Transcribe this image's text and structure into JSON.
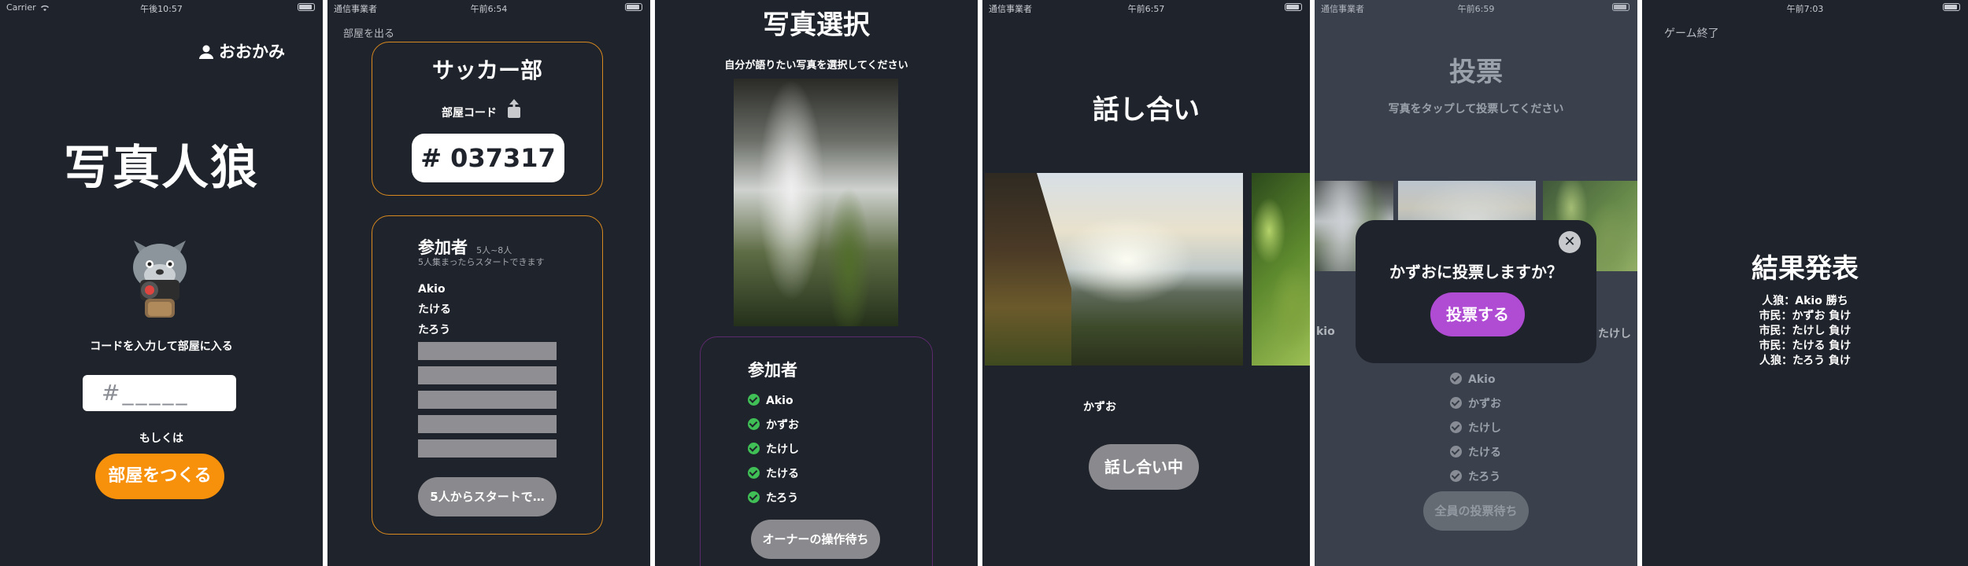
{
  "screens": {
    "s1": {
      "status": {
        "carrier": "Carrier",
        "time": "午後10:57"
      },
      "user_name": "おおかみ",
      "title": "写真人狼",
      "prompt": "コードを入力して部屋に入る",
      "code_placeholder": "#_____",
      "or_text": "もしくは",
      "create_button": "部屋をつくる"
    },
    "s2": {
      "status": {
        "carrier": "通信事業者",
        "time": "午前6:54"
      },
      "leave": "部屋を出る",
      "room_name": "サッカー部",
      "room_code_label": "部屋コード",
      "room_code": "# 037317",
      "participants_title": "参加者",
      "participants_range": "5人~8人",
      "participants_note": "5人集まったらスタートできます",
      "participants": [
        "Akio",
        "たける",
        "たろう"
      ],
      "start_button": "5人からスタートで…"
    },
    "s3": {
      "title": "写真選択",
      "instruction": "自分が語りたい写真を選択してください",
      "participants_title": "参加者",
      "participants": [
        "Akio",
        "かずお",
        "たけし",
        "たける",
        "たろう"
      ],
      "wait_button": "オーナーの操作待ち"
    },
    "s4": {
      "status": {
        "carrier": "通信事業者",
        "time": "午前6:57"
      },
      "title": "話し合い",
      "speaker": "かずお",
      "discussing_button": "話し合い中"
    },
    "s5": {
      "status": {
        "carrier": "通信事業者",
        "time": "午前6:59"
      },
      "title": "投票",
      "instruction": "写真をタップして投票してください",
      "side_label_left": "kio",
      "side_label_right": "たけし",
      "modal_question": "かずおに投票しますか？",
      "vote_button": "投票する",
      "close": "✕",
      "participants": [
        "Akio",
        "かずお",
        "たけし",
        "たける",
        "たろう"
      ],
      "waiting_button": "全員の投票待ち"
    },
    "s6": {
      "status": {
        "time": "午前7:03"
      },
      "end_game": "ゲーム終了",
      "title": "結果発表",
      "results": [
        "人狼：Akio 勝ち",
        "市民：かずお 負け",
        "市民：たけし 負け",
        "市民：たける 負け",
        "人狼：たろう 負け"
      ]
    }
  },
  "colors": {
    "background": "#1f232b",
    "orange": "#f7900a",
    "purple": "#b04bd4",
    "green_check": "#3fbf55"
  }
}
